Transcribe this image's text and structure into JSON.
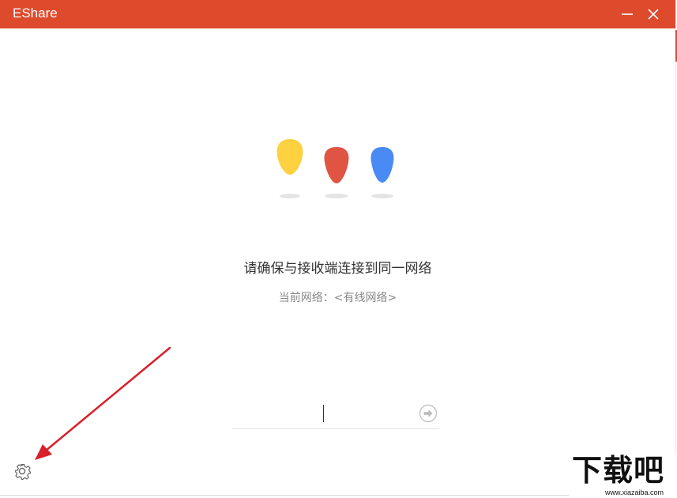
{
  "window": {
    "title": "EShare"
  },
  "titlebar": {
    "minimize_icon": "minimize-icon",
    "close_icon": "close-icon"
  },
  "main": {
    "hint": "请确保与接收端连接到同一网络",
    "network_label": "当前网络：",
    "network_name": "<有线网络>",
    "code_input": {
      "value": "",
      "placeholder": ""
    },
    "submit_icon": "arrow-right-circle-icon"
  },
  "drops": [
    {
      "name": "yellow-drop",
      "color": "#fdd13f"
    },
    {
      "name": "red-drop",
      "color": "#e05443"
    },
    {
      "name": "blue-drop",
      "color": "#4a8af4"
    }
  ],
  "footer": {
    "settings_icon": "gear-icon"
  },
  "watermark": {
    "text": "下载吧",
    "url": "www.xiazaiba.com"
  },
  "colors": {
    "accent": "#dd4a2c",
    "arrow": "#d8202a"
  }
}
